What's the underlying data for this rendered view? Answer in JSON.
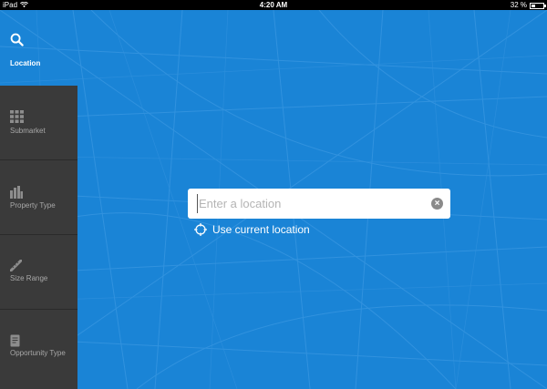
{
  "status_bar": {
    "device": "iPad",
    "time": "4:20 AM",
    "battery_percent": "32 %",
    "battery_level": 0.32
  },
  "nav": {
    "active": {
      "label": "Location",
      "icon": "search-icon"
    },
    "items": [
      {
        "label": "Submarket",
        "icon": "grid-icon"
      },
      {
        "label": "Property Type",
        "icon": "buildings-icon"
      },
      {
        "label": "Size Range",
        "icon": "ruler-icon"
      },
      {
        "label": "Opportunity Type",
        "icon": "document-icon"
      }
    ]
  },
  "search": {
    "placeholder": "Enter a location",
    "value": ""
  },
  "current_location": {
    "label": "Use current location",
    "icon": "crosshair-icon"
  },
  "colors": {
    "background": "#1a84d6",
    "sidebar": "#3a3a3a",
    "sidebar_text": "#a8a8a8"
  }
}
